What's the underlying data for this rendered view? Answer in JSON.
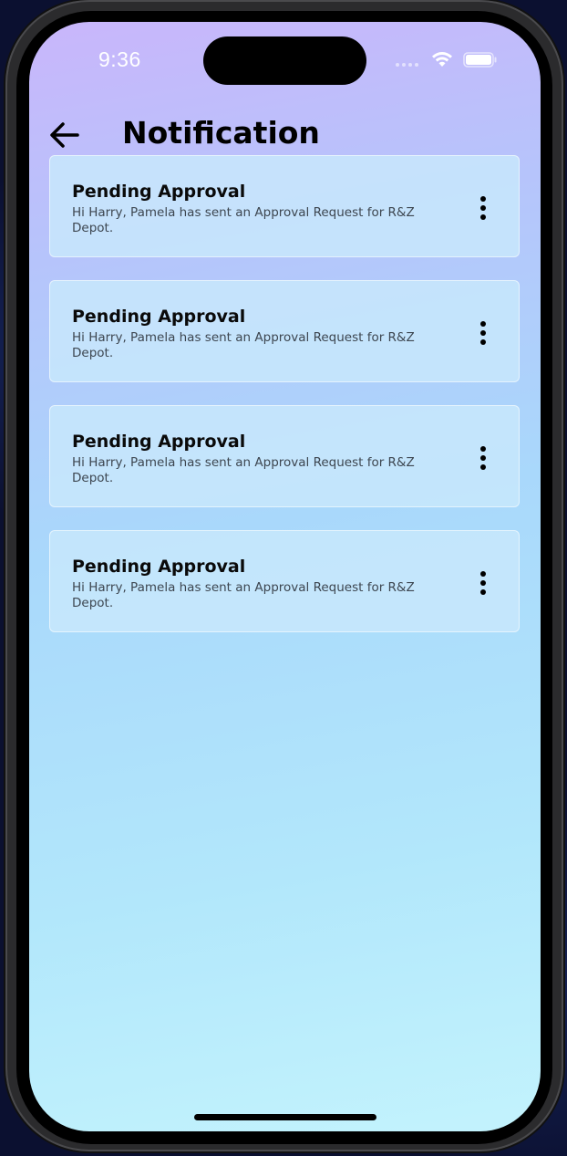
{
  "status_bar": {
    "time": "9:36",
    "icons": [
      "signal-dots-icon",
      "wifi-icon",
      "battery-icon"
    ]
  },
  "header": {
    "back_icon": "arrow-left-icon",
    "title": "Notification"
  },
  "notifications": [
    {
      "title": "Pending Approval",
      "body": "Hi Harry, Pamela has sent an Approval Request for R&Z Depot.",
      "menu_icon": "more-vertical-icon"
    },
    {
      "title": "Pending Approval",
      "body": "Hi Harry, Pamela has sent an Approval Request for R&Z Depot.",
      "menu_icon": "more-vertical-icon"
    },
    {
      "title": "Pending Approval",
      "body": "Hi Harry, Pamela has sent an Approval Request for R&Z Depot.",
      "menu_icon": "more-vertical-icon"
    },
    {
      "title": "Pending Approval",
      "body": "Hi Harry, Pamela has sent an Approval Request for R&Z Depot.",
      "menu_icon": "more-vertical-icon"
    }
  ],
  "colors": {
    "gradient_top": "#c9b6fb",
    "gradient_bottom": "#c3f3fd",
    "card_background": "#c8e8fc",
    "title_text": "#0a0a0a",
    "body_text": "#3d4650"
  }
}
